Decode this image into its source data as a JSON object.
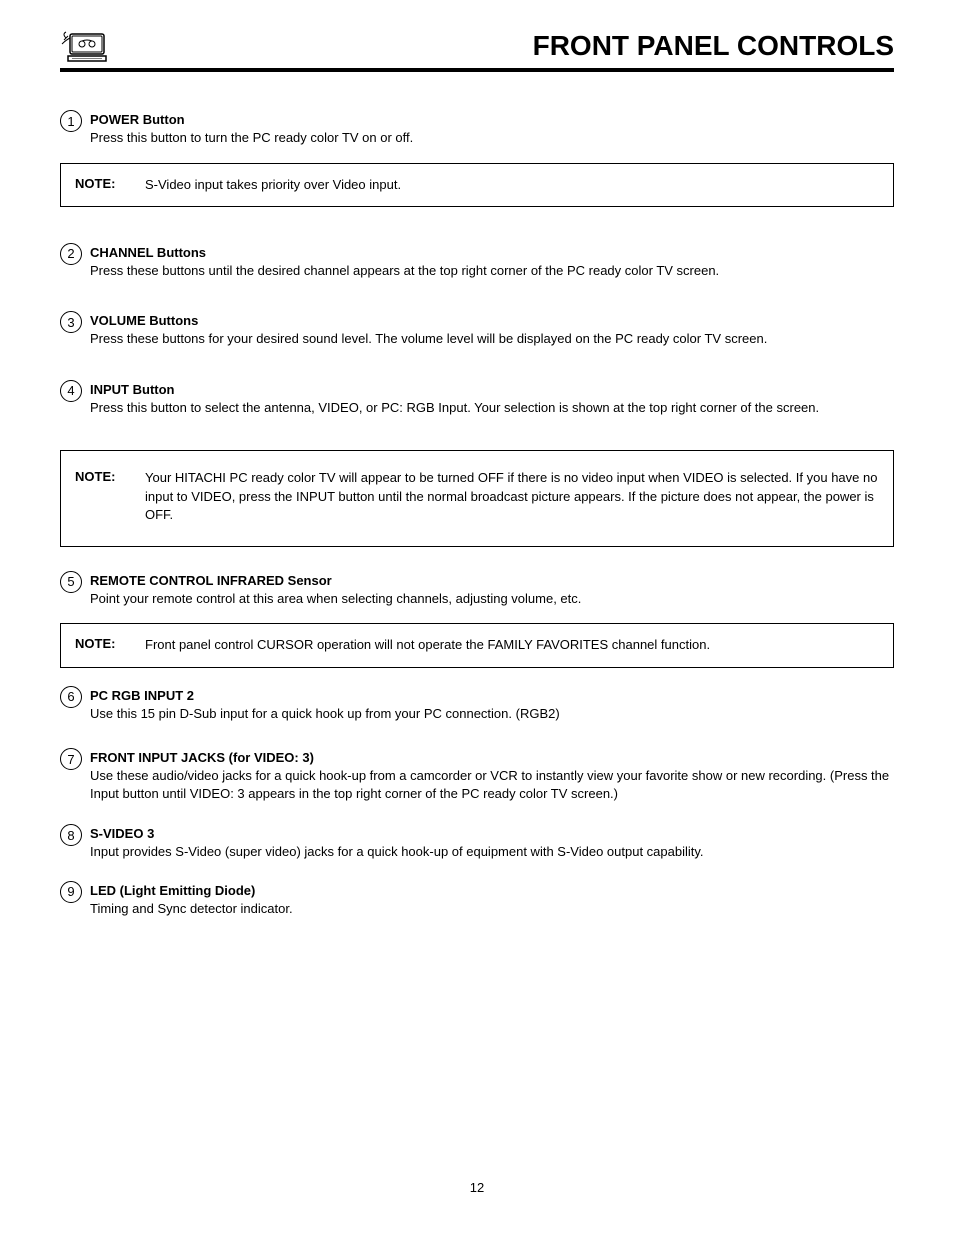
{
  "header": {
    "title": "FRONT PANEL CONTROLS"
  },
  "items": [
    {
      "num": "1",
      "title": "POWER Button",
      "desc": "Press this button to turn the PC ready color TV on or off."
    },
    {
      "num": "2",
      "title": "CHANNEL Buttons",
      "desc": "Press these buttons until the desired channel appears at the top right corner of the PC ready color TV screen."
    },
    {
      "num": "3",
      "title": "VOLUME Buttons",
      "desc": "Press these buttons for your desired sound level. The volume level will be displayed on the PC ready color TV screen."
    },
    {
      "num": "4",
      "title": "INPUT Button",
      "desc": "Press this button to select the antenna, VIDEO, or PC: RGB Input.  Your selection is shown at the top right corner of the screen."
    },
    {
      "num": "5",
      "title": "REMOTE CONTROL INFRARED Sensor",
      "desc": "Point your remote control at this area when selecting channels, adjusting volume, etc."
    },
    {
      "num": "6",
      "title": "PC RGB INPUT 2",
      "desc": "Use this 15 pin D-Sub input for a  quick  hook up from your PC connection. (RGB2)"
    },
    {
      "num": "7",
      "title": "FRONT INPUT JACKS (for VIDEO: 3)",
      "desc": "Use these audio/video jacks for a  quick  hook-up from a camcorder or VCR to instantly view your favorite show or new recording.  (Press the Input button until VIDEO: 3 appears in the top right corner of the PC ready color TV screen.)"
    },
    {
      "num": "8",
      "title": "S-VIDEO 3",
      "desc": "Input provides S-Video (super video) jacks for a  quick  hook-up of equipment with S-Video output capability."
    },
    {
      "num": "9",
      "title": "LED (Light Emitting Diode)",
      "desc": "Timing and Sync detector indicator."
    }
  ],
  "notes": {
    "label": "NOTE:",
    "n1": "S-Video input takes priority over Video input.",
    "n2": "Your HITACHI PC ready color TV will appear to be turned OFF if there is no video input when VIDEO is selected. If you have no input to VIDEO, press the INPUT button until the normal broadcast picture appears. If the picture does not appear, the power is OFF.",
    "n3": "Front panel control CURSOR operation will not operate the FAMILY FAVORITES channel function."
  },
  "page_number": "12"
}
